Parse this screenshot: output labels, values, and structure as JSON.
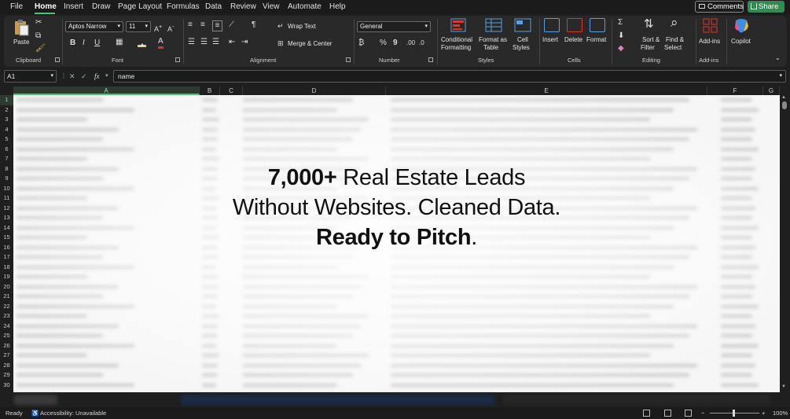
{
  "menu": {
    "items": [
      "File",
      "Home",
      "Insert",
      "Draw",
      "Page Layout",
      "Formulas",
      "Data",
      "Review",
      "View",
      "Automate",
      "Help"
    ],
    "active": "Home",
    "comments_label": "Comments",
    "share_label": "Share"
  },
  "ribbon": {
    "clipboard": {
      "label": "Clipboard",
      "paste": "Paste"
    },
    "font": {
      "label": "Font",
      "font_name": "Aptos Narrow",
      "font_size": "11",
      "bold": "B",
      "italic": "I",
      "underline": "U"
    },
    "alignment": {
      "label": "Alignment",
      "wrap_text": "Wrap Text",
      "merge_center": "Merge & Center"
    },
    "number": {
      "label": "Number",
      "format": "General",
      "percent": "%",
      "comma": "9"
    },
    "styles": {
      "label": "Styles",
      "conditional_1": "Conditional",
      "conditional_2": "Formatting",
      "format_table_1": "Format as",
      "format_table_2": "Table",
      "cell_styles_1": "Cell",
      "cell_styles_2": "Styles"
    },
    "cells": {
      "label": "Cells",
      "insert": "Insert",
      "delete": "Delete",
      "format": "Format"
    },
    "editing": {
      "label": "Editing",
      "sort_1": "Sort &",
      "sort_2": "Filter",
      "find_1": "Find &",
      "find_2": "Select"
    },
    "addins": {
      "label": "Add-ins",
      "addins": "Add-ins"
    },
    "copilot": {
      "label": "Copilot"
    }
  },
  "formula_bar": {
    "name_box": "A1",
    "fx": "fx",
    "value": "name"
  },
  "columns": [
    "A",
    "B",
    "C",
    "D",
    "E",
    "F",
    "G"
  ],
  "rows": [
    "1",
    "2",
    "3",
    "4",
    "5",
    "6",
    "7",
    "8",
    "9",
    "10",
    "11",
    "12",
    "13",
    "14",
    "15",
    "16",
    "17",
    "18",
    "19",
    "20",
    "21",
    "22",
    "23",
    "24",
    "25",
    "26",
    "27",
    "28",
    "29",
    "30"
  ],
  "overlay": {
    "line1_bold": "7,000+",
    "line1_rest": " Real Estate Leads",
    "line2": "Without Websites. Cleaned Data.",
    "line3_bold": "Ready to Pitch",
    "line3_rest": "."
  },
  "status": {
    "ready": "Ready",
    "accessibility": "Accessibility: Unavailable",
    "zoom": "100%"
  }
}
